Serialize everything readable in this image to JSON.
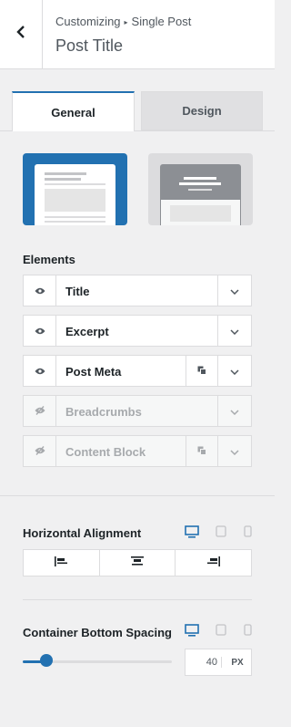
{
  "header": {
    "breadcrumb_root": "Customizing",
    "breadcrumb_separator": "▸",
    "breadcrumb_section": "Single Post",
    "title": "Post Title"
  },
  "tabs": [
    {
      "label": "General",
      "active": true
    },
    {
      "label": "Design",
      "active": false
    }
  ],
  "layouts": [
    {
      "name": "layout-above-content",
      "selected": true
    },
    {
      "name": "layout-hero-banner",
      "selected": false
    }
  ],
  "elements": {
    "label": "Elements",
    "items": [
      {
        "label": "Title",
        "visible": true,
        "has_options": false
      },
      {
        "label": "Excerpt",
        "visible": true,
        "has_options": false
      },
      {
        "label": "Post Meta",
        "visible": true,
        "has_options": true
      },
      {
        "label": "Breadcrumbs",
        "visible": false,
        "has_options": false
      },
      {
        "label": "Content Block",
        "visible": false,
        "has_options": true
      }
    ]
  },
  "horizontal_alignment": {
    "label": "Horizontal Alignment",
    "active_device": "desktop",
    "options": [
      "left-align-icon",
      "center-align-icon",
      "right-align-icon"
    ]
  },
  "container_bottom_spacing": {
    "label": "Container Bottom Spacing",
    "active_device": "desktop",
    "value": "40",
    "unit": "PX",
    "slider_fraction": 0.16
  },
  "colors": {
    "accent": "#2271b1",
    "border": "#dcdcde",
    "background": "#f0f0f1",
    "muted_icon": "#a7aaad"
  }
}
